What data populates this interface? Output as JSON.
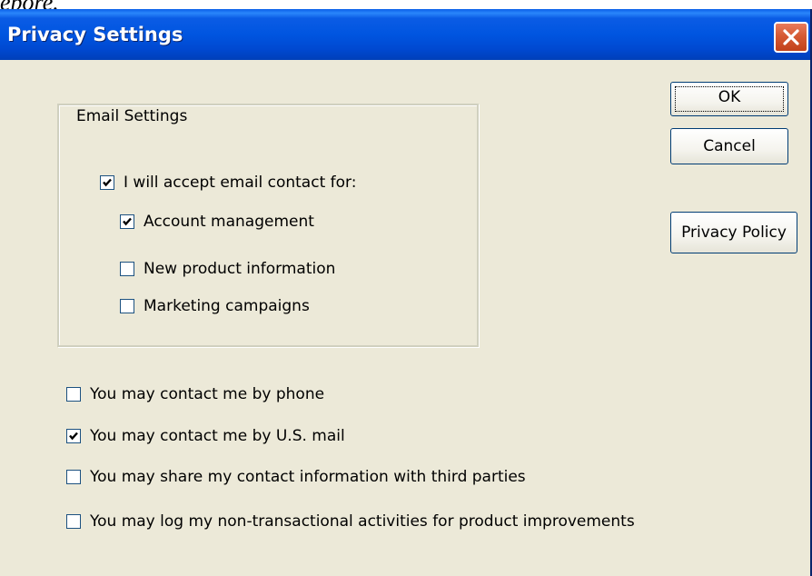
{
  "top_fragment": "epore.",
  "window": {
    "title": "Privacy Settings"
  },
  "buttons": {
    "ok": "OK",
    "cancel": "Cancel",
    "privacy_policy": "Privacy Policy"
  },
  "email_group": {
    "legend": "Email Settings",
    "accept": {
      "label": "I will accept  email contact for:",
      "checked": true
    },
    "items": [
      {
        "label": "Account management",
        "checked": true
      },
      {
        "label": "New product information",
        "checked": false
      },
      {
        "label": "Marketing campaigns",
        "checked": false
      }
    ]
  },
  "options": [
    {
      "label": "You may contact me by phone",
      "checked": false
    },
    {
      "label": "You may contact me by U.S. mail",
      "checked": true
    },
    {
      "label": "You may share my contact information with third parties",
      "checked": false
    },
    {
      "label": "You may log my non-transactional activities for product improvements",
      "checked": false
    }
  ],
  "icons": {
    "close": "close-icon",
    "check": "checkmark-icon"
  }
}
